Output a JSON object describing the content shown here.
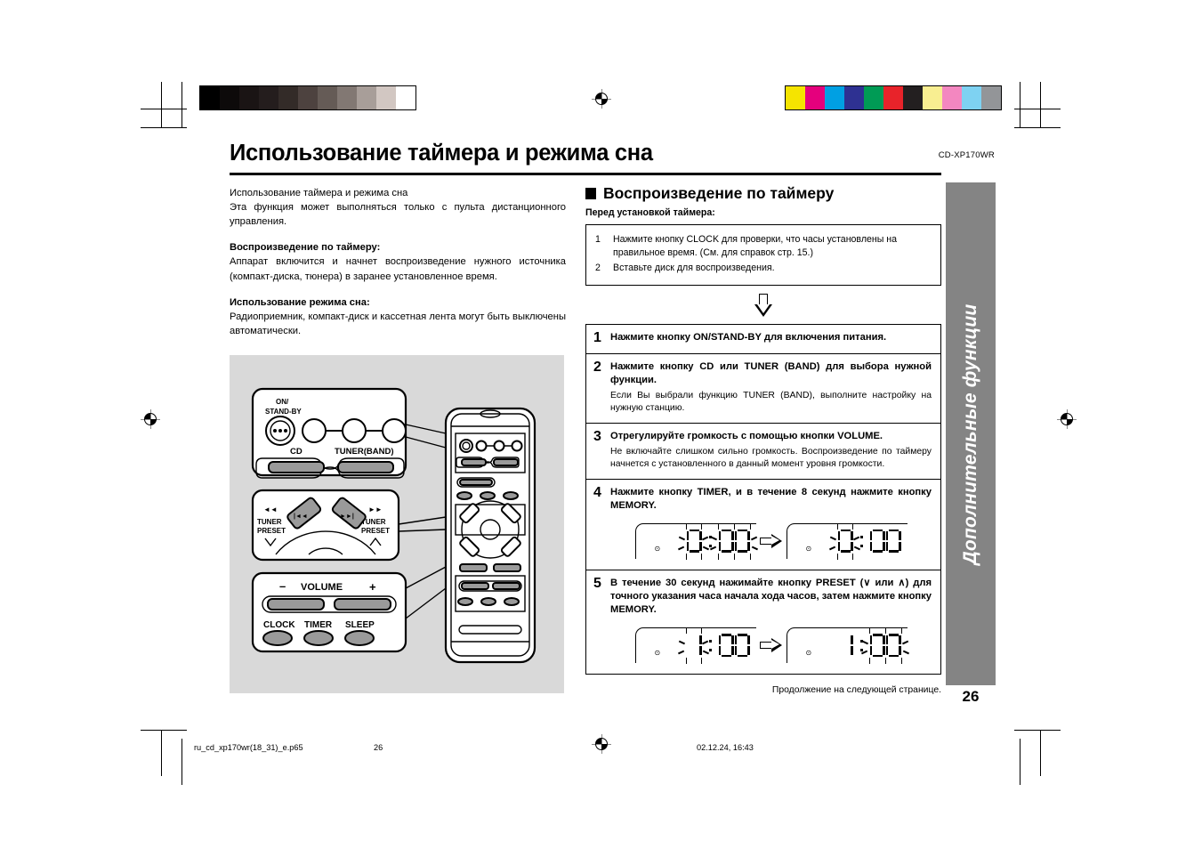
{
  "document": {
    "title": "Использование таймера и режима сна",
    "model_code": "CD-XP170WR",
    "page_number": "26",
    "side_tab_label": "Дополнительные функции"
  },
  "left_column": {
    "intro_line": "Использование таймера и режима сна",
    "intro_body": "Эта функция может выполняться только с пульта дистанционного управления.",
    "sections": [
      {
        "heading": "Воспроизведение по таймеру:",
        "body": "Аппарат включится и начнет воспроизведение нужного источника (компакт-диска, тюнера) в заранее установленное время."
      },
      {
        "heading": "Использование режима сна:",
        "body": "Радиоприемник, компакт-диск и кассетная лента могут быть выключены автоматически."
      }
    ],
    "illustration": {
      "callout_power": {
        "on_standby_label": "ON/\nSTAND-BY",
        "cd_label": "CD",
        "tuner_label": "TUNER(BAND)"
      },
      "callout_preset": {
        "left_rew": "◄◄",
        "right_ff": "►►",
        "tuner_preset_down": "TUNER\nPRESET",
        "tuner_preset_up": "TUNER\nPRESET",
        "skip_back": "|◄◄",
        "skip_fwd": "►►|"
      },
      "callout_volume": {
        "minus": "–",
        "volume_label": "VOLUME",
        "plus": "+",
        "clock_label": "CLOCK",
        "timer_label": "TIMER",
        "sleep_label": "SLEEP"
      }
    }
  },
  "right_column": {
    "section_title": "Воспроизведение по таймеру",
    "subheading": "Перед установкой таймера:",
    "prep_items": [
      {
        "num": "1",
        "text": "Нажмите кнопку CLOCK для проверки, что часы установлены на правильное время. (См. для справок стр. 15.)"
      },
      {
        "num": "2",
        "text": "Вставьте диск для воспроизведения."
      }
    ],
    "steps": [
      {
        "num": "1",
        "heading": "Нажмите кнопку ON/STAND-BY для включения питания.",
        "description": ""
      },
      {
        "num": "2",
        "heading": "Нажмите кнопку CD или TUNER (BAND) для выбора нужной функции.",
        "description": "Если Вы выбрали функцию TUNER (BAND), выполните настройку на нужную станцию."
      },
      {
        "num": "3",
        "heading": "Отрегулируйте громкость с помощью кнопки VOLUME.",
        "description": "Не включайте слишком сильно громкость. Воспроизведение по таймеру начнется с установленного в данный момент уровня громкости."
      },
      {
        "num": "4",
        "heading": "Нажмите кнопку TIMER, и в течение 8 секунд нажмите кнопку MEMORY.",
        "description": "",
        "displays": [
          {
            "value": "0:00",
            "blinking": "all"
          },
          {
            "value": "0:00",
            "blinking": "hour"
          }
        ]
      },
      {
        "num": "5",
        "heading": "В течение 30 секунд нажимайте кнопку PRESET (∨ или ∧) для точного указания часа начала хода часов, затем нажмите кнопку MEMORY.",
        "description": "",
        "displays": [
          {
            "value": "1:00",
            "blinking": "hour"
          },
          {
            "value": "1:00",
            "blinking": "minutes"
          }
        ]
      }
    ],
    "continuation_note": "Продолжение на следующей странице."
  },
  "footer": {
    "filename": "ru_cd_xp170wr(18_31)_e.p65",
    "page": "26",
    "timestamp": "02.12.24, 16:43"
  },
  "color_bars": {
    "grayscale": [
      "#000000",
      "#0d0a0a",
      "#1a1414",
      "#241d1d",
      "#332b28",
      "#4d423f",
      "#655b56",
      "#827873",
      "#a89e99",
      "#d2c7c2",
      "#ffffff"
    ],
    "process": [
      "#f5e400",
      "#e5007d",
      "#00a0e3",
      "#2e3192",
      "#009b55",
      "#e8232a",
      "#231f20",
      "#f8ee91",
      "#f387c0",
      "#7ed2f2",
      "#939598"
    ]
  }
}
